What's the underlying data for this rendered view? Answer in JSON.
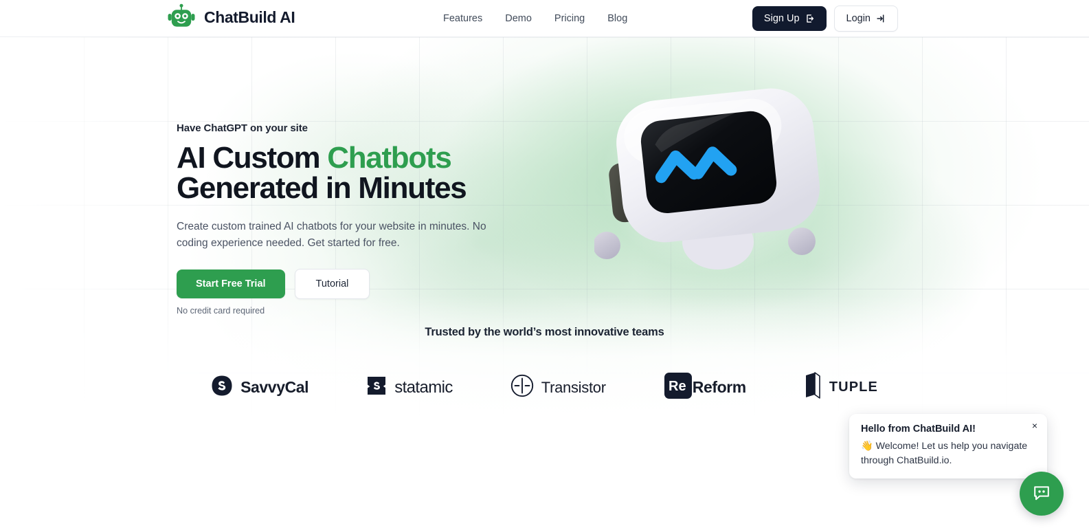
{
  "brand": {
    "name": "ChatBuild AI",
    "logo_icon": "robot-head-icon",
    "accent_green": "#2E9E4F",
    "dark": "#111A2E"
  },
  "nav": {
    "items": [
      {
        "label": "Features"
      },
      {
        "label": "Demo"
      },
      {
        "label": "Pricing"
      },
      {
        "label": "Blog"
      }
    ],
    "signup_label": "Sign Up",
    "signup_icon": "sign-up-arrow-icon",
    "login_label": "Login",
    "login_icon": "login-arrow-icon"
  },
  "hero": {
    "eyebrow": "Have ChatGPT on your site",
    "headline_part1": "AI Custom ",
    "headline_highlight": "Chatbots",
    "headline_part2": "Generated in Minutes",
    "subcopy": "Create custom trained AI chatbots for your website in minutes. No coding experience needed. Get started for free.",
    "primary_cta": "Start Free Trial",
    "secondary_cta": "Tutorial",
    "note": "No credit card required",
    "illustration_icon": "robot-mascot-illustration"
  },
  "trusted": {
    "title": "Trusted by the world’s most innovative teams",
    "logos": [
      {
        "name": "SavvyCal",
        "icon": "savvycal-logo-icon"
      },
      {
        "name": "statamic",
        "icon": "statamic-logo-icon"
      },
      {
        "name": "Transistor",
        "icon": "transistor-logo-icon"
      },
      {
        "name": "Reform",
        "icon": "reform-logo-icon"
      },
      {
        "name": "TUPLE",
        "icon": "tuple-logo-icon"
      }
    ]
  },
  "chat_widget": {
    "popup_title": "Hello from ChatBuild AI!",
    "popup_message": "👋 Welcome! Let us help you navigate through ChatBuild.io.",
    "close_label": "×",
    "fab_icon": "chat-bubble-icon"
  }
}
